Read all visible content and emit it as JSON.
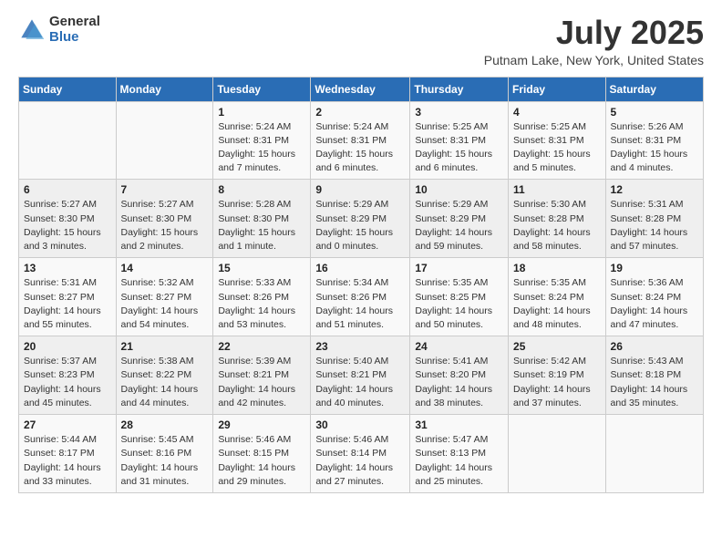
{
  "header": {
    "logo_general": "General",
    "logo_blue": "Blue",
    "title": "July 2025",
    "location": "Putnam Lake, New York, United States"
  },
  "weekdays": [
    "Sunday",
    "Monday",
    "Tuesday",
    "Wednesday",
    "Thursday",
    "Friday",
    "Saturday"
  ],
  "weeks": [
    [
      {
        "day": "",
        "info": ""
      },
      {
        "day": "",
        "info": ""
      },
      {
        "day": "1",
        "info": "Sunrise: 5:24 AM\nSunset: 8:31 PM\nDaylight: 15 hours and 7 minutes."
      },
      {
        "day": "2",
        "info": "Sunrise: 5:24 AM\nSunset: 8:31 PM\nDaylight: 15 hours and 6 minutes."
      },
      {
        "day": "3",
        "info": "Sunrise: 5:25 AM\nSunset: 8:31 PM\nDaylight: 15 hours and 6 minutes."
      },
      {
        "day": "4",
        "info": "Sunrise: 5:25 AM\nSunset: 8:31 PM\nDaylight: 15 hours and 5 minutes."
      },
      {
        "day": "5",
        "info": "Sunrise: 5:26 AM\nSunset: 8:31 PM\nDaylight: 15 hours and 4 minutes."
      }
    ],
    [
      {
        "day": "6",
        "info": "Sunrise: 5:27 AM\nSunset: 8:30 PM\nDaylight: 15 hours and 3 minutes."
      },
      {
        "day": "7",
        "info": "Sunrise: 5:27 AM\nSunset: 8:30 PM\nDaylight: 15 hours and 2 minutes."
      },
      {
        "day": "8",
        "info": "Sunrise: 5:28 AM\nSunset: 8:30 PM\nDaylight: 15 hours and 1 minute."
      },
      {
        "day": "9",
        "info": "Sunrise: 5:29 AM\nSunset: 8:29 PM\nDaylight: 15 hours and 0 minutes."
      },
      {
        "day": "10",
        "info": "Sunrise: 5:29 AM\nSunset: 8:29 PM\nDaylight: 14 hours and 59 minutes."
      },
      {
        "day": "11",
        "info": "Sunrise: 5:30 AM\nSunset: 8:28 PM\nDaylight: 14 hours and 58 minutes."
      },
      {
        "day": "12",
        "info": "Sunrise: 5:31 AM\nSunset: 8:28 PM\nDaylight: 14 hours and 57 minutes."
      }
    ],
    [
      {
        "day": "13",
        "info": "Sunrise: 5:31 AM\nSunset: 8:27 PM\nDaylight: 14 hours and 55 minutes."
      },
      {
        "day": "14",
        "info": "Sunrise: 5:32 AM\nSunset: 8:27 PM\nDaylight: 14 hours and 54 minutes."
      },
      {
        "day": "15",
        "info": "Sunrise: 5:33 AM\nSunset: 8:26 PM\nDaylight: 14 hours and 53 minutes."
      },
      {
        "day": "16",
        "info": "Sunrise: 5:34 AM\nSunset: 8:26 PM\nDaylight: 14 hours and 51 minutes."
      },
      {
        "day": "17",
        "info": "Sunrise: 5:35 AM\nSunset: 8:25 PM\nDaylight: 14 hours and 50 minutes."
      },
      {
        "day": "18",
        "info": "Sunrise: 5:35 AM\nSunset: 8:24 PM\nDaylight: 14 hours and 48 minutes."
      },
      {
        "day": "19",
        "info": "Sunrise: 5:36 AM\nSunset: 8:24 PM\nDaylight: 14 hours and 47 minutes."
      }
    ],
    [
      {
        "day": "20",
        "info": "Sunrise: 5:37 AM\nSunset: 8:23 PM\nDaylight: 14 hours and 45 minutes."
      },
      {
        "day": "21",
        "info": "Sunrise: 5:38 AM\nSunset: 8:22 PM\nDaylight: 14 hours and 44 minutes."
      },
      {
        "day": "22",
        "info": "Sunrise: 5:39 AM\nSunset: 8:21 PM\nDaylight: 14 hours and 42 minutes."
      },
      {
        "day": "23",
        "info": "Sunrise: 5:40 AM\nSunset: 8:21 PM\nDaylight: 14 hours and 40 minutes."
      },
      {
        "day": "24",
        "info": "Sunrise: 5:41 AM\nSunset: 8:20 PM\nDaylight: 14 hours and 38 minutes."
      },
      {
        "day": "25",
        "info": "Sunrise: 5:42 AM\nSunset: 8:19 PM\nDaylight: 14 hours and 37 minutes."
      },
      {
        "day": "26",
        "info": "Sunrise: 5:43 AM\nSunset: 8:18 PM\nDaylight: 14 hours and 35 minutes."
      }
    ],
    [
      {
        "day": "27",
        "info": "Sunrise: 5:44 AM\nSunset: 8:17 PM\nDaylight: 14 hours and 33 minutes."
      },
      {
        "day": "28",
        "info": "Sunrise: 5:45 AM\nSunset: 8:16 PM\nDaylight: 14 hours and 31 minutes."
      },
      {
        "day": "29",
        "info": "Sunrise: 5:46 AM\nSunset: 8:15 PM\nDaylight: 14 hours and 29 minutes."
      },
      {
        "day": "30",
        "info": "Sunrise: 5:46 AM\nSunset: 8:14 PM\nDaylight: 14 hours and 27 minutes."
      },
      {
        "day": "31",
        "info": "Sunrise: 5:47 AM\nSunset: 8:13 PM\nDaylight: 14 hours and 25 minutes."
      },
      {
        "day": "",
        "info": ""
      },
      {
        "day": "",
        "info": ""
      }
    ]
  ]
}
